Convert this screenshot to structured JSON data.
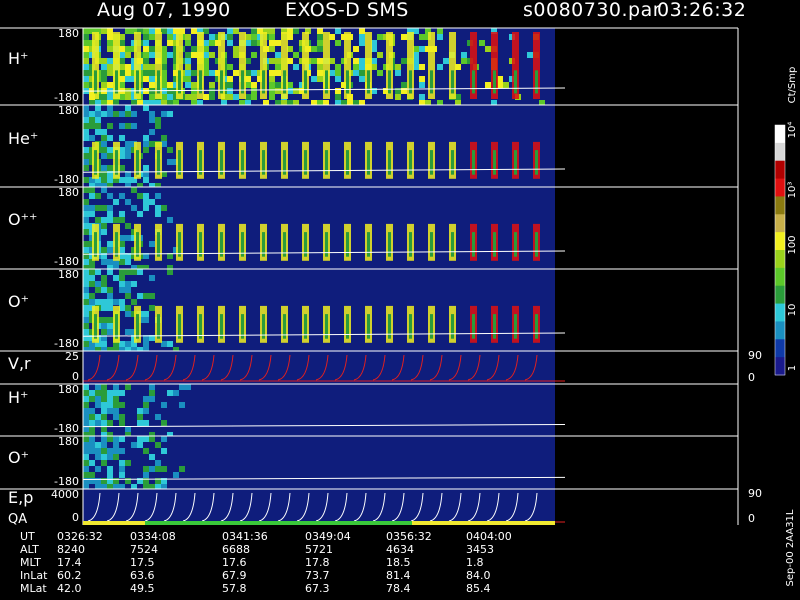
{
  "header": {
    "date": "Aug 07, 1990",
    "instrument": "EXOS-D SMS",
    "file": "s0080730.par",
    "time": "03:26:32"
  },
  "colorbar": {
    "unit": "Ct/Smp",
    "ticks": [
      "1",
      "10",
      "100",
      "10³",
      "10⁴"
    ],
    "colors": [
      "#1a1a8c",
      "#0f3aa8",
      "#1a8fc0",
      "#2ec8d8",
      "#2a9c3a",
      "#5cc82a",
      "#9ad21c",
      "#f2f020",
      "#c8b04a",
      "#8a7a10",
      "#e01010",
      "#b00000",
      "#d8d8d8",
      "#ffffff"
    ]
  },
  "footer": {
    "code": "Sep-00 2AA31L"
  },
  "chart_data": {
    "type": "heatmap",
    "panels": [
      {
        "id": "h_plus",
        "label": "H⁺",
        "ytop": "180",
        "ybot": "-180",
        "rtop": "",
        "rbot": ""
      },
      {
        "id": "he_plus",
        "label": "He⁺",
        "ytop": "180",
        "ybot": "-180",
        "rtop": "",
        "rbot": ""
      },
      {
        "id": "o_pp",
        "label": "O⁺⁺",
        "ytop": "180",
        "ybot": "-180",
        "rtop": "",
        "rbot": ""
      },
      {
        "id": "o_plus",
        "label": "O⁺",
        "ytop": "180",
        "ybot": "-180",
        "rtop": "",
        "rbot": ""
      },
      {
        "id": "vr",
        "label": "V,r",
        "ytop": "25",
        "ybot": "0",
        "rtop": "90",
        "rbot": "0"
      },
      {
        "id": "h_plus_2",
        "label": "H⁺",
        "ytop": "180",
        "ybot": "-180",
        "rtop": "",
        "rbot": ""
      },
      {
        "id": "o_plus_2",
        "label": "O⁺",
        "ytop": "180",
        "ybot": "-180",
        "rtop": "",
        "rbot": ""
      },
      {
        "id": "ep",
        "label": "E,p",
        "ytop": "4000",
        "ybot": "0",
        "rtop": "90",
        "rbot": "0"
      }
    ],
    "qa_label": "QA",
    "ephemeris": {
      "labels": [
        "UT",
        "ALT",
        "MLT",
        "InLat",
        "MLat"
      ],
      "columns": [
        [
          "0326:32",
          "8240",
          "17.4",
          "60.2",
          "42.0"
        ],
        [
          "0334:08",
          "7524",
          "17.5",
          "63.6",
          "49.5"
        ],
        [
          "0341:36",
          "6688",
          "17.6",
          "67.9",
          "57.8"
        ],
        [
          "0349:04",
          "5721",
          "17.8",
          "73.7",
          "67.3"
        ],
        [
          "0356:32",
          "4634",
          "18.5",
          "81.4",
          "78.4"
        ],
        [
          "0404:00",
          "3453",
          "1.8",
          "84.0",
          "85.4"
        ]
      ]
    }
  }
}
